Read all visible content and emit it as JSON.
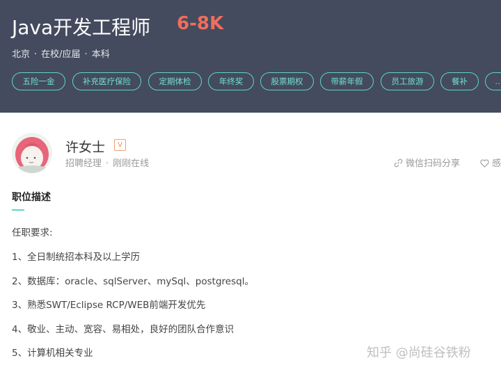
{
  "job": {
    "title": "Java开发工程师",
    "salary": "6-8K",
    "location": "北京",
    "experience": "在校/应届",
    "education": "本科",
    "separator": "·"
  },
  "benefits": [
    "五险一金",
    "补充医疗保险",
    "定期体检",
    "年终奖",
    "股票期权",
    "带薪年假",
    "员工旅游",
    "餐补",
    "…"
  ],
  "recruiter": {
    "name": "许女士",
    "verify_badge": "V",
    "role": "招聘经理",
    "status": "刚刚在线",
    "dot": "·"
  },
  "actions": {
    "share_label": "微信扫码分享",
    "fav_label": "感"
  },
  "description": {
    "title": "职位描述",
    "lines": [
      "任职要求:",
      "1、全日制统招本科及以上学历",
      "2、数据库：oracle、sqlServer、mySql、postgresql。",
      "3、熟悉SWT/Eclipse RCP/WEB前端开发优先",
      "4、敬业、主动、宽容、易相处，良好的团队合作意识",
      "5、计算机相关专业"
    ]
  },
  "watermark": "知乎 @尚硅谷铁粉",
  "colors": {
    "header_bg": "#444b5f",
    "salary": "#f26d5b",
    "tag_accent": "#5fd4c8"
  }
}
